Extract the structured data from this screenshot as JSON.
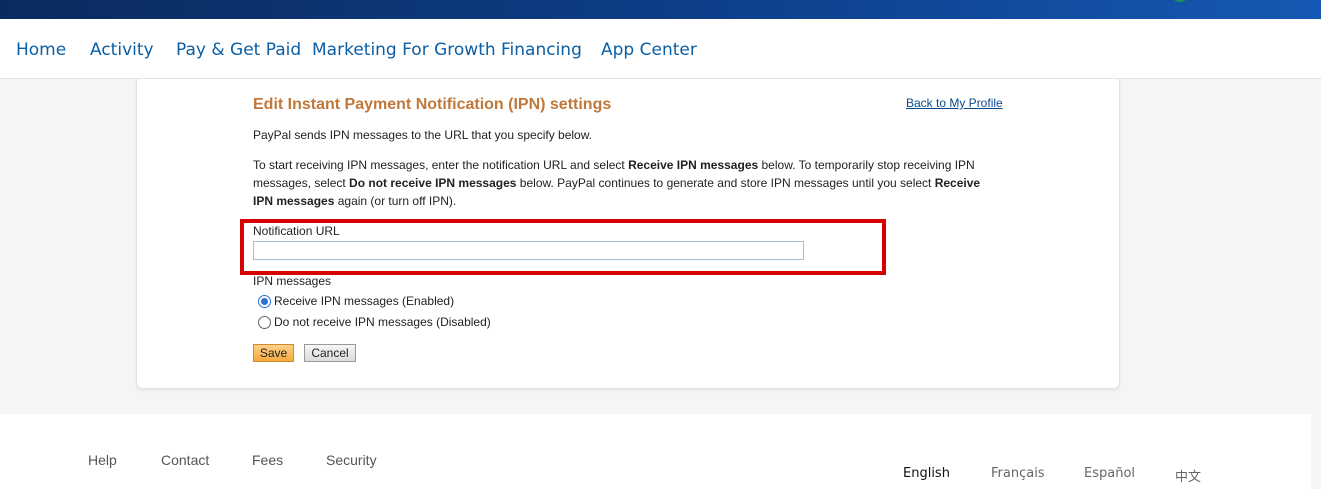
{
  "nav": {
    "items": [
      "Home",
      "Activity",
      "Pay & Get Paid",
      "Marketing For Growth",
      "Financing",
      "App Center"
    ]
  },
  "ipn": {
    "title": "Edit Instant Payment Notification (IPN) settings",
    "back_link": "Back to My Profile",
    "intro": "PayPal sends IPN messages to the URL that you specify below.",
    "desc_1": "To start receiving IPN messages, enter the notification URL and select ",
    "desc_b1": "Receive IPN messages",
    "desc_2": " below. To temporarily stop receiving IPN messages, select ",
    "desc_b2": "Do not receive IPN messages",
    "desc_3": " below. PayPal continues to generate and store IPN messages until you select ",
    "desc_b3": "Receive IPN messages",
    "desc_4": " again (or turn off IPN).",
    "url_label": "Notification URL",
    "url_value": "",
    "messages_label": "IPN messages",
    "option_enabled": "Receive IPN messages (Enabled)",
    "option_disabled": "Do not receive IPN messages (Disabled)",
    "selected_option": "enabled",
    "save_label": "Save",
    "cancel_label": "Cancel"
  },
  "footer": {
    "links": [
      "Help",
      "Contact",
      "Fees",
      "Security"
    ],
    "languages": [
      "English",
      "Français",
      "Español",
      "中文"
    ],
    "active_language": "English"
  },
  "colors": {
    "title": "#c0783a",
    "nav_link": "#0b5fa5",
    "highlight": "#d60000",
    "save_button": "#f5a93a"
  }
}
